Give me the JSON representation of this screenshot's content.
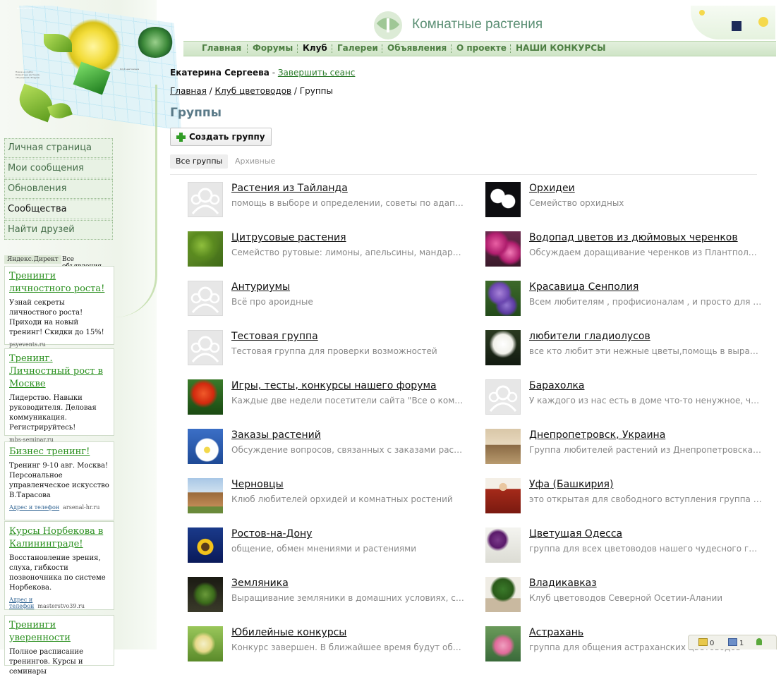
{
  "site": {
    "name": "Комнатные растения",
    "hero_notes": [
      "Новое на сайте: Комнатные растения, обсуждения, Форумы",
      "Ваши растения",
      "Клуб цветоводов"
    ]
  },
  "main_nav": [
    {
      "label": "Главная"
    },
    {
      "label": "Форумы"
    },
    {
      "label": "Клуб",
      "active": true
    },
    {
      "label": "Галереи"
    },
    {
      "label": "Объявления"
    },
    {
      "label": "О проекте"
    },
    {
      "label": "НАШИ КОНКУРСЫ"
    }
  ],
  "left_nav": [
    {
      "label": "Личная страница"
    },
    {
      "label": "Мои сообщения"
    },
    {
      "label": "Обновления"
    },
    {
      "label": "Сообщества",
      "active": true
    },
    {
      "label": "Найти друзей"
    }
  ],
  "ads": {
    "tab_direct": "Яндекс.Директ",
    "tab_all": "Все объявления",
    "items": [
      {
        "title": "Тренинги личностного роста!",
        "text": "Узнай секреты личностного роста! Приходи на новый тренинг! Скидки до 15%!",
        "domain": "psyevents.ru",
        "address": ""
      },
      {
        "title": "Тренинг. Личностный рост в Москве",
        "text": "Лидерство. Навыки руководителя. Деловая коммуникация. Регистрируйтесь!",
        "domain": "mbs-seminar.ru",
        "address": ""
      },
      {
        "title": "Бизнес тренинг!",
        "text": "Тренинг 9-10 авг. Москва! Персональное управленческое искусство В.Тарасова",
        "domain": "arsenal-hr.ru",
        "address": "Адрес и телефон"
      },
      {
        "title": "Курсы Норбекова в Калининграде!",
        "text": "Восстановление зрения, слуха, гибкости позвоночника по системе Норбекова.",
        "domain": "masterstvo39.ru",
        "address": "Адрес и телефон"
      },
      {
        "title": "Тренинги уверенности",
        "text": "Полное расписание тренингов. Курсы и семинары",
        "domain": "",
        "address": ""
      }
    ]
  },
  "session": {
    "user_name": "Екатерина Сергеева",
    "separator": " - ",
    "logout": "Завершить сеанс"
  },
  "breadcrumb": {
    "home": "Главная",
    "sep": " / ",
    "club": "Клуб цветоводов",
    "current": "Группы"
  },
  "page_title": "Группы",
  "create_group_label": "Создать группу",
  "tabs": {
    "all": "Все группы",
    "archive": "Архивные"
  },
  "groups": [
    {
      "name": "Растения из Тайланда",
      "desc": "помощь в выборе и определении, советы по адаптации",
      "thumb": "placeholder"
    },
    {
      "name": "Орхидеи",
      "desc": "Семейство орхидных",
      "thumb": "orchid"
    },
    {
      "name": "Цитрусовые растения",
      "desc": "Семейство рутовые: лимоны, апельсины, мандарины и другие",
      "thumb": "citrus"
    },
    {
      "name": "Водопад цветов из дюймовых черенков",
      "desc": "Обсуждаем доращивание черенков из Плантпола. Петунии",
      "thumb": "petunia"
    },
    {
      "name": "Антуриумы",
      "desc": "Всё про ароидные",
      "thumb": "placeholder"
    },
    {
      "name": "Красавица Сенполия",
      "desc": "Всем любителям , профисионалам , и просто для тех кто любит",
      "thumb": "violet"
    },
    {
      "name": "Тестовая группа",
      "desc": "Тестовая группа для проверки возможностей",
      "thumb": "placeholder"
    },
    {
      "name": "любители гладиолусов",
      "desc": "все кто любит эти нежные цветы,помощь в выращивании",
      "thumb": "gladiolus"
    },
    {
      "name": "Игры, тесты, конкурсы нашего форума",
      "desc": "Каждые две недели посетители сайта \"Все о комнатных растениях\"",
      "thumb": "zinnia"
    },
    {
      "name": "Барахолка",
      "desc": "У каждого из нас есть в доме что-то ненужное, что может пригодиться",
      "thumb": "placeholder"
    },
    {
      "name": "Заказы растений",
      "desc": "Обсуждение вопросов, связанных с заказами растений",
      "thumb": "daisy"
    },
    {
      "name": "Днепропетровск, Украина",
      "desc": "Группа любителей растений из Днепропетровска и области",
      "thumb": "city"
    },
    {
      "name": "Черновцы",
      "desc": "Клюб любителей орхидей и комнатных ростений",
      "thumb": "building"
    },
    {
      "name": "Уфа (Башкирия)",
      "desc": "это открытая для свободного вступления группа любителей",
      "thumb": "doll"
    },
    {
      "name": "Ростов-на-Дону",
      "desc": "общение, обмен мнениями и растениями",
      "thumb": "sunflower"
    },
    {
      "name": "Цветущая Одесса",
      "desc": "группа для всех цветоводов нашего чудесного города",
      "thumb": "odessa"
    },
    {
      "name": "Земляника",
      "desc": "Выращивание земляники в домашних условиях, советы",
      "thumb": "strawberry"
    },
    {
      "name": "Владикавказ",
      "desc": "Клуб цветоводов Северной Осетии-Алании",
      "thumb": "pot"
    },
    {
      "name": "Юбилейные конкурсы",
      "desc": "Конкурс завершен. В ближайшее время будут объявлены итоги",
      "thumb": "lily"
    },
    {
      "name": "Астрахань",
      "desc": "группа для общения астраханских цветоводов",
      "thumb": "lotus"
    }
  ],
  "status_bar": {
    "notes": "0",
    "messages": "1"
  },
  "colors": {
    "accent": "#2f9b24",
    "nav_text": "#4e7f43",
    "title": "#5a7a88",
    "ad_link": "#2a8f1e"
  }
}
